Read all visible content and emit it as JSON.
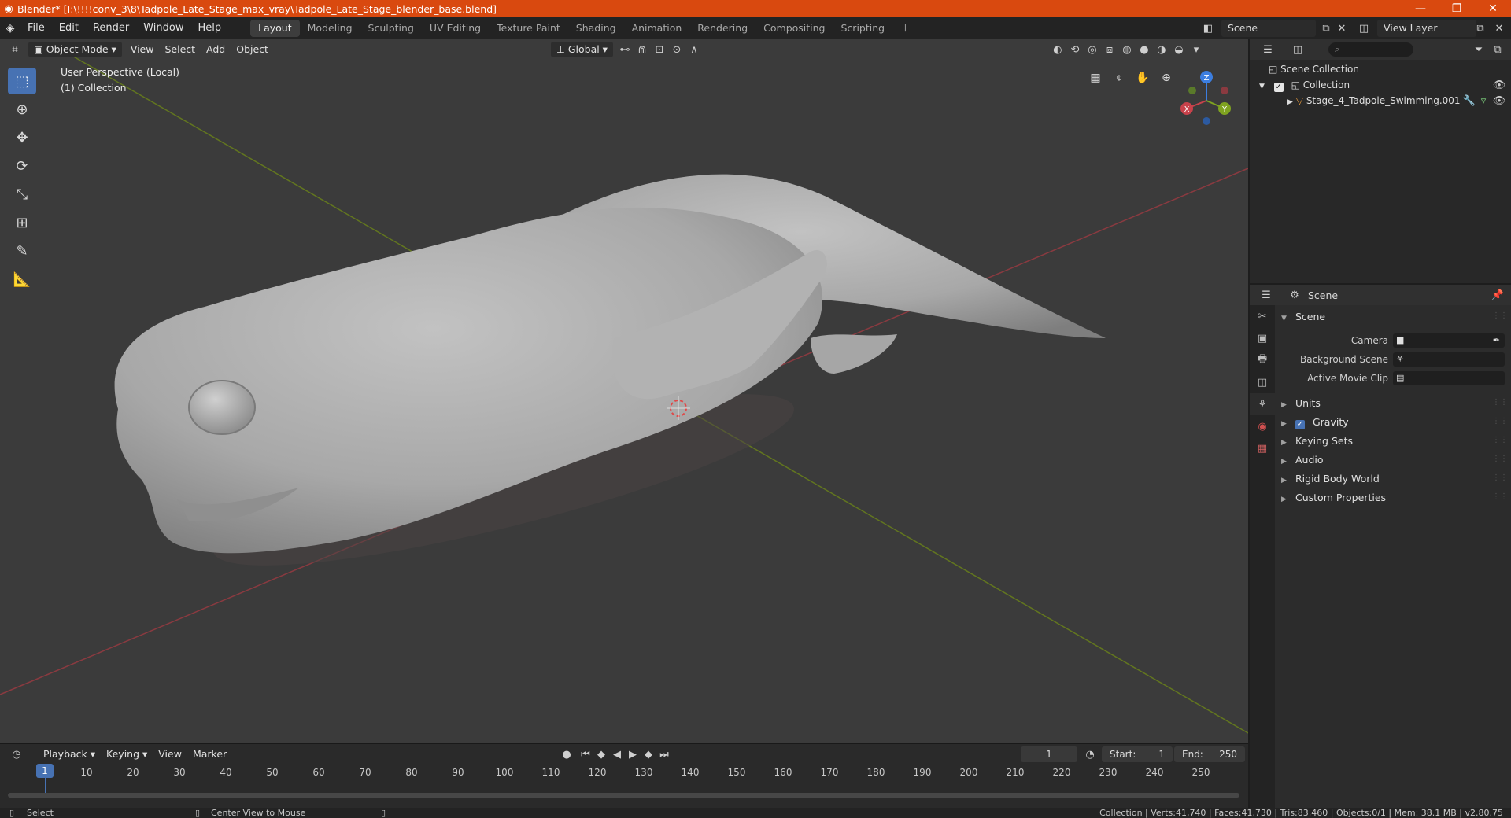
{
  "title_bar": {
    "title": "Blender* [I:\\!!!!conv_3\\8\\Tadpole_Late_Stage_max_vray\\Tadpole_Late_Stage_blender_base.blend]",
    "minimize": "—",
    "maximize": "❐",
    "close": "✕"
  },
  "menu": [
    "File",
    "Edit",
    "Render",
    "Window",
    "Help"
  ],
  "workspaces": [
    "Layout",
    "Modeling",
    "Sculpting",
    "UV Editing",
    "Texture Paint",
    "Shading",
    "Animation",
    "Rendering",
    "Compositing",
    "Scripting"
  ],
  "active_workspace": "Layout",
  "scene_name": "Scene",
  "view_layer_name": "View Layer",
  "viewport": {
    "mode": "Object Mode",
    "menus": [
      "View",
      "Select",
      "Add",
      "Object"
    ],
    "transform_orientation": "Global",
    "perspective_label": "User Perspective (Local)",
    "collection_label": "(1) Collection",
    "gizmo": {
      "x": "X",
      "y": "Y",
      "z": "Z"
    }
  },
  "timeline": {
    "menus": [
      "Playback",
      "Keying",
      "View",
      "Marker"
    ],
    "current_frame": "1",
    "start_label": "Start:",
    "start": "1",
    "end_label": "End:",
    "end": "250",
    "ruler": [
      "10",
      "20",
      "30",
      "40",
      "50",
      "60",
      "70",
      "80",
      "90",
      "100",
      "110",
      "120",
      "130",
      "140",
      "150",
      "160",
      "170",
      "180",
      "190",
      "200",
      "210",
      "220",
      "230",
      "240",
      "250"
    ],
    "playhead_frame": "1"
  },
  "status_bar": {
    "left_action": "Select",
    "middle_action": "Center View to Mouse",
    "stats": "Collection | Verts:41,740 | Faces:41,730 | Tris:83,460 | Objects:0/1 | Mem: 38.1 MB | v2.80.75"
  },
  "outliner": {
    "root": "Scene Collection",
    "collection": "Collection",
    "object": "Stage_4_Tadpole_Swimming.001"
  },
  "properties": {
    "header": "Scene",
    "panel_title": "Scene",
    "fields": [
      {
        "label": "Camera"
      },
      {
        "label": "Background Scene"
      },
      {
        "label": "Active Movie Clip"
      }
    ],
    "sections": [
      "Units",
      "Gravity",
      "Keying Sets",
      "Audio",
      "Rigid Body World",
      "Custom Properties"
    ],
    "gravity_checked": true
  },
  "colors": {
    "title_bar": "#d9490f",
    "accent": "#4772b3",
    "x_axis": "#c8424b",
    "y_axis": "#7fa320",
    "z_axis": "#3c7ee0"
  }
}
